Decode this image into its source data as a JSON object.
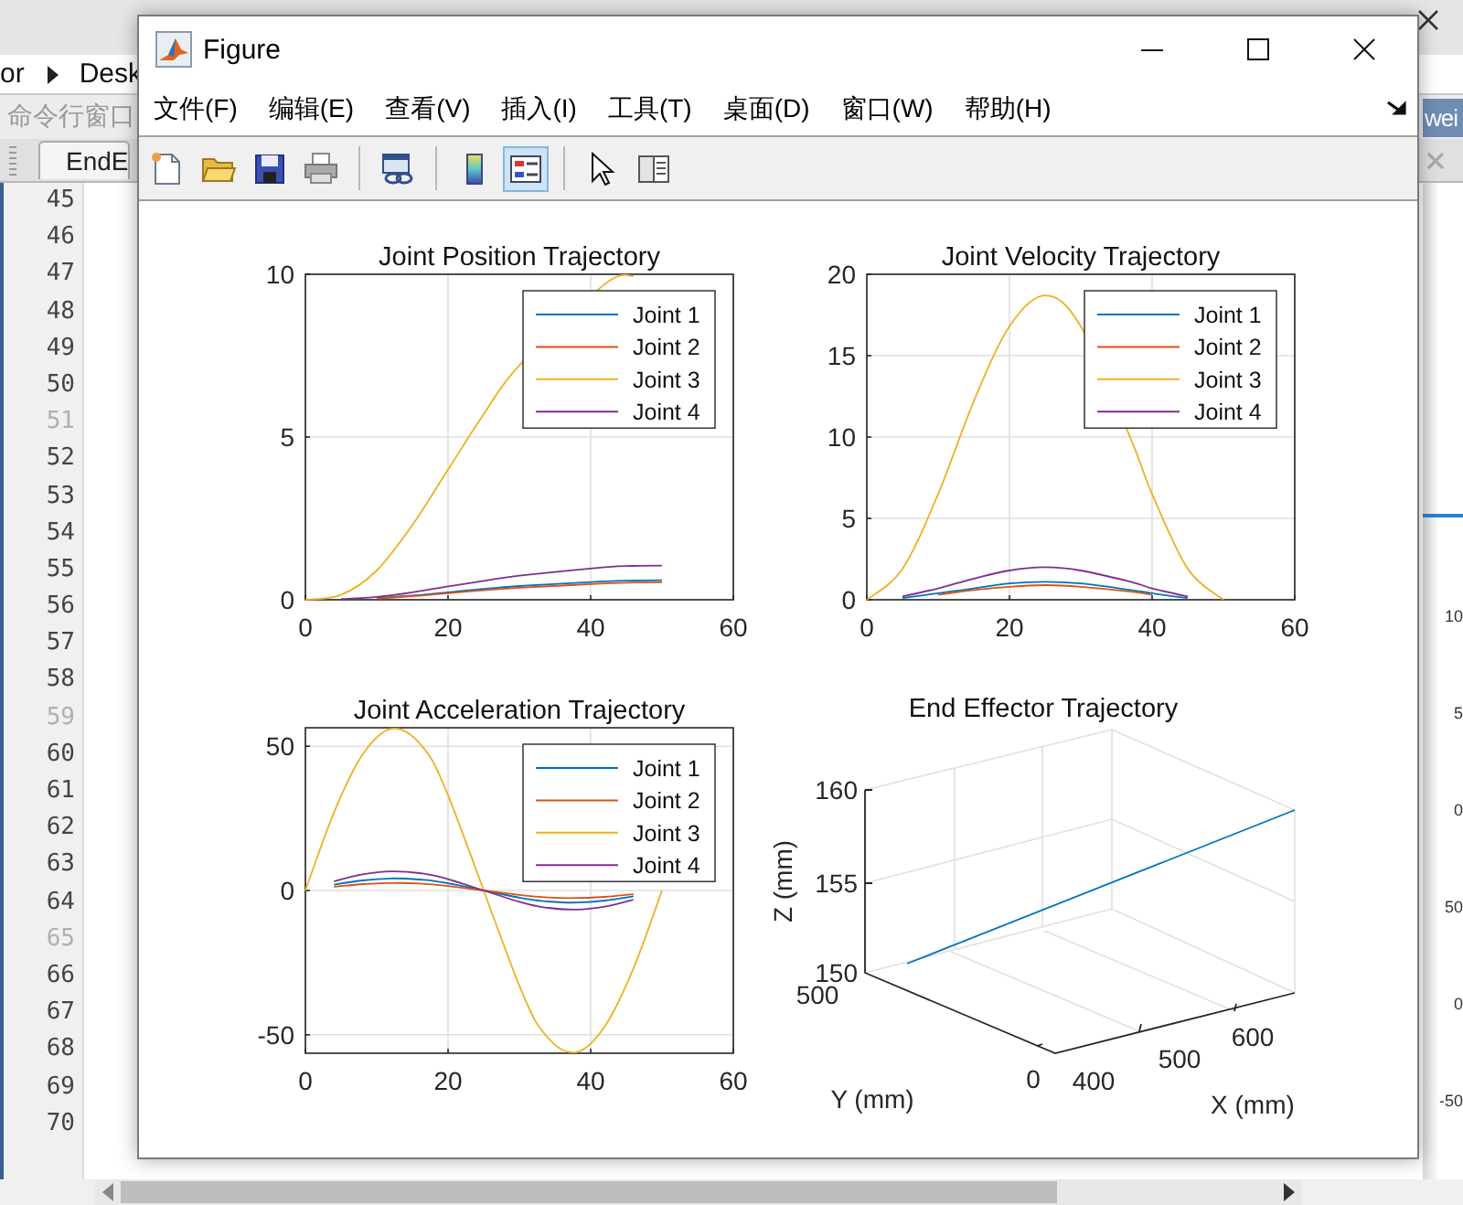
{
  "background": {
    "breadcrumb": [
      "or",
      "Desk"
    ],
    "command_window": "命令行窗口",
    "editor_tab": "EndE",
    "side_tab": "wei",
    "line_numbers": [
      {
        "number": "45",
        "dim": false
      },
      {
        "number": "46",
        "dim": false
      },
      {
        "number": "47",
        "dim": false
      },
      {
        "number": "48",
        "dim": false
      },
      {
        "number": "49",
        "dim": false
      },
      {
        "number": "50",
        "dim": false
      },
      {
        "number": "51",
        "dim": true
      },
      {
        "number": "52",
        "dim": false
      },
      {
        "number": "53",
        "dim": false
      },
      {
        "number": "54",
        "dim": false
      },
      {
        "number": "55",
        "dim": false
      },
      {
        "number": "56",
        "dim": false
      },
      {
        "number": "57",
        "dim": false
      },
      {
        "number": "58",
        "dim": false
      },
      {
        "number": "59",
        "dim": true
      },
      {
        "number": "60",
        "dim": false
      },
      {
        "number": "61",
        "dim": false
      },
      {
        "number": "62",
        "dim": false
      },
      {
        "number": "63",
        "dim": false
      },
      {
        "number": "64",
        "dim": false
      },
      {
        "number": "65",
        "dim": true
      },
      {
        "number": "66",
        "dim": false
      },
      {
        "number": "67",
        "dim": false
      },
      {
        "number": "68",
        "dim": false
      },
      {
        "number": "69",
        "dim": false
      },
      {
        "number": "70",
        "dim": false
      }
    ],
    "side_ticks": [
      "10",
      "5",
      "0",
      "50",
      "0",
      "-50"
    ]
  },
  "figure": {
    "title": "Figure",
    "menu": [
      "文件(F)",
      "编辑(E)",
      "查看(V)",
      "插入(I)",
      "工具(T)",
      "桌面(D)",
      "窗口(W)",
      "帮助(H)"
    ],
    "toolbar": [
      {
        "kind": "new",
        "pressed": false
      },
      {
        "kind": "open",
        "pressed": false
      },
      {
        "kind": "save",
        "pressed": false
      },
      {
        "kind": "print",
        "pressed": false
      },
      {
        "kind": "separator"
      },
      {
        "kind": "link",
        "pressed": false
      },
      {
        "kind": "separator"
      },
      {
        "kind": "colorbar",
        "pressed": false
      },
      {
        "kind": "legend",
        "pressed": true
      },
      {
        "kind": "separator"
      },
      {
        "kind": "pointer",
        "pressed": false
      },
      {
        "kind": "property",
        "pressed": false
      }
    ],
    "plots": [
      {
        "kind": "line2d",
        "chart_data": {
          "type": "line",
          "title": "Joint Position Trajectory",
          "x": [
            0,
            5,
            10,
            15,
            20,
            25,
            30,
            42,
            46,
            50
          ],
          "xlim": [
            0,
            60
          ],
          "ylim": [
            0,
            10
          ],
          "xticks": [
            {
              "value": 0,
              "label": "0"
            },
            {
              "value": 20,
              "label": "20"
            },
            {
              "value": 40,
              "label": "40"
            },
            {
              "value": 60,
              "label": "60"
            }
          ],
          "yticks": [
            {
              "value": 0,
              "label": "0"
            },
            {
              "value": 5,
              "label": "5"
            },
            {
              "value": 10,
              "label": "10"
            }
          ],
          "grid": true,
          "legend": true,
          "series": [
            {
              "name": "Joint 1",
              "color": "#0072bd",
              "values": [
                null,
                null,
                0.05,
                0.13,
                0.23,
                0.33,
                0.42,
                0.57,
                0.59,
                0.6
              ]
            },
            {
              "name": "Joint 2",
              "color": "#d95319",
              "values": [
                null,
                null,
                0.04,
                0.11,
                0.2,
                0.29,
                0.37,
                0.5,
                0.53,
                0.54
              ]
            },
            {
              "name": "Joint 3",
              "color": "#edb120",
              "values": [
                0,
                0.15,
                0.9,
                2.3,
                4.0,
                5.7,
                7.2,
                9.7,
                9.95,
                null
              ]
            },
            {
              "name": "Joint 4",
              "color": "#7e2f8e",
              "values": [
                null,
                0.02,
                0.09,
                0.23,
                0.41,
                0.58,
                0.74,
                1.0,
                1.04,
                1.05
              ]
            }
          ]
        }
      },
      {
        "kind": "line2d",
        "chart_data": {
          "type": "line",
          "title": "Joint Velocity Trajectory",
          "x": [
            0,
            5,
            10,
            15,
            20,
            25,
            30,
            37,
            40,
            45,
            50
          ],
          "xlim": [
            0,
            60
          ],
          "ylim": [
            0,
            20
          ],
          "xticks": [
            {
              "value": 0,
              "label": "0"
            },
            {
              "value": 20,
              "label": "20"
            },
            {
              "value": 40,
              "label": "40"
            },
            {
              "value": 60,
              "label": "60"
            }
          ],
          "yticks": [
            {
              "value": 0,
              "label": "0"
            },
            {
              "value": 5,
              "label": "5"
            },
            {
              "value": 10,
              "label": "10"
            },
            {
              "value": 15,
              "label": "15"
            },
            {
              "value": 20,
              "label": "20"
            }
          ],
          "grid": true,
          "legend": true,
          "series": [
            {
              "name": "Joint 1",
              "color": "#0072bd",
              "values": [
                null,
                0.1,
                0.4,
                0.7,
                1,
                1.1,
                1,
                0.6,
                0.4,
                0.1,
                null
              ]
            },
            {
              "name": "Joint 2",
              "color": "#d95319",
              "values": [
                null,
                null,
                0.3,
                0.6,
                0.8,
                0.9,
                0.8,
                0.5,
                0.3,
                null,
                null
              ]
            },
            {
              "name": "Joint 3",
              "color": "#edb120",
              "values": [
                0,
                1.9,
                6.5,
                12.2,
                16.8,
                18.7,
                16.8,
                9.9,
                6.5,
                1.9,
                0
              ]
            },
            {
              "name": "Joint 4",
              "color": "#7e2f8e",
              "values": [
                null,
                0.2,
                0.7,
                1.3,
                1.8,
                2,
                1.8,
                1.1,
                0.7,
                0.2,
                null
              ]
            }
          ]
        }
      },
      {
        "kind": "line2d",
        "chart_data": {
          "type": "line",
          "title": "Joint Acceleration Trajectory",
          "x": [
            0,
            4,
            8,
            12,
            16,
            20,
            30,
            34,
            38,
            42,
            46,
            50
          ],
          "xlim": [
            0,
            60
          ],
          "ylim": [
            -56.4,
            56.4
          ],
          "xticks": [
            {
              "value": 0,
              "label": "0"
            },
            {
              "value": 20,
              "label": "20"
            },
            {
              "value": 40,
              "label": "40"
            },
            {
              "value": 60,
              "label": "60"
            }
          ],
          "yticks": [
            {
              "value": -50,
              "label": "-50"
            },
            {
              "value": 0,
              "label": "0"
            },
            {
              "value": 50,
              "label": "50"
            }
          ],
          "grid": true,
          "legend": true,
          "series": [
            {
              "name": "Joint 1",
              "color": "#0072bd",
              "values": [
                null,
                2,
                3.5,
                4.2,
                3.8,
                2.5,
                -2.5,
                -3.8,
                -4.2,
                -3.5,
                -2,
                null
              ]
            },
            {
              "name": "Joint 2",
              "color": "#d95319",
              "values": [
                null,
                1.3,
                2.2,
                2.6,
                2.4,
                1.5,
                -1.5,
                -2.4,
                -2.6,
                -2.2,
                -1.3,
                null
              ]
            },
            {
              "name": "Joint 3",
              "color": "#edb120",
              "values": [
                0,
                27,
                47,
                56,
                51,
                33,
                -33,
                -51,
                -56,
                -47,
                -27,
                0
              ]
            },
            {
              "name": "Joint 4",
              "color": "#7e2f8e",
              "values": [
                null,
                3.2,
                5.6,
                6.6,
                6,
                3.9,
                -3.9,
                -6,
                -6.6,
                -5.6,
                -3.2,
                null
              ]
            }
          ]
        }
      },
      {
        "kind": "plot3d",
        "title": "End Effector Trajectory",
        "zlabel": "Z (mm)",
        "ylabel": "Y (mm)",
        "xlabel": "X (mm)",
        "zticks": [
          "160",
          "155",
          "150"
        ],
        "yticks": [
          "500",
          "0"
        ],
        "xticks": [
          "400",
          "500",
          "600"
        ]
      }
    ]
  }
}
